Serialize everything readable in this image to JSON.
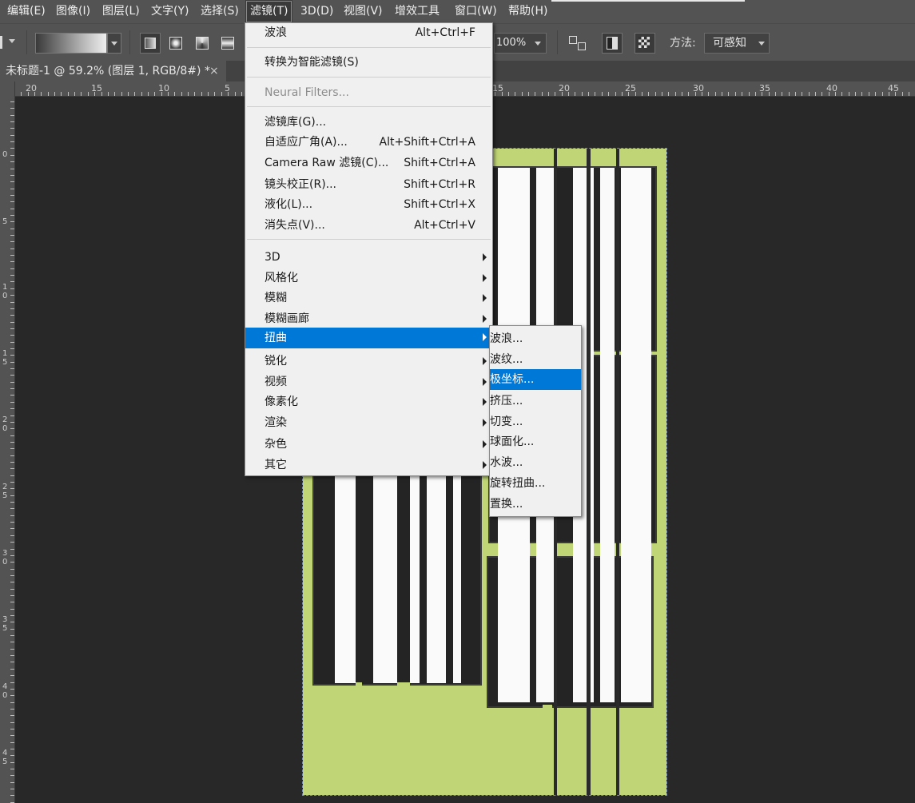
{
  "menubar": {
    "items": [
      "编辑(E)",
      "图像(I)",
      "图层(L)",
      "文字(Y)",
      "选择(S)",
      "滤镜(T)",
      "3D(D)",
      "视图(V)",
      "增效工具",
      "窗口(W)",
      "帮助(H)"
    ],
    "active": "滤镜(T)"
  },
  "options": {
    "zoom": "100%",
    "method_label": "方法:",
    "method_value": "可感知"
  },
  "document": {
    "tab_title": "未标题-1 @ 59.2% (图层 1, RGB/8#) *",
    "close": "×"
  },
  "rulers": {
    "h_labels": [
      "20",
      "15",
      "10",
      "5",
      "15",
      "20",
      "25",
      "30",
      "35",
      "40",
      "45"
    ],
    "v_labels": [
      "0",
      "5",
      "10",
      "15",
      "20",
      "25",
      "30",
      "35",
      "40",
      "45"
    ]
  },
  "filter_menu": {
    "last_filter": {
      "label": "波浪",
      "shortcut": "Alt+Ctrl+F"
    },
    "smart": {
      "label": "转换为智能滤镜(S)"
    },
    "neural": {
      "label": "Neural Filters..."
    },
    "group1": [
      {
        "label": "滤镜库(G)...",
        "shortcut": ""
      },
      {
        "label": "自适应广角(A)...",
        "shortcut": "Alt+Shift+Ctrl+A"
      },
      {
        "label": "Camera Raw 滤镜(C)...",
        "shortcut": "Shift+Ctrl+A"
      },
      {
        "label": "镜头校正(R)...",
        "shortcut": "Shift+Ctrl+R"
      },
      {
        "label": "液化(L)...",
        "shortcut": "Shift+Ctrl+X"
      },
      {
        "label": "消失点(V)...",
        "shortcut": "Alt+Ctrl+V"
      }
    ],
    "submenus": [
      "3D",
      "风格化",
      "模糊",
      "模糊画廊",
      "扭曲",
      "锐化",
      "视频",
      "像素化",
      "渲染",
      "杂色",
      "其它"
    ],
    "highlighted": "扭曲"
  },
  "distort_submenu": {
    "items": [
      "波浪...",
      "波纹...",
      "极坐标...",
      "挤压...",
      "切变...",
      "球面化...",
      "水波...",
      "旋转扭曲...",
      "置换..."
    ],
    "highlighted": "极坐标..."
  },
  "colors": {
    "menu_highlight": "#0078d7",
    "canvas_green": "#c0d575"
  }
}
